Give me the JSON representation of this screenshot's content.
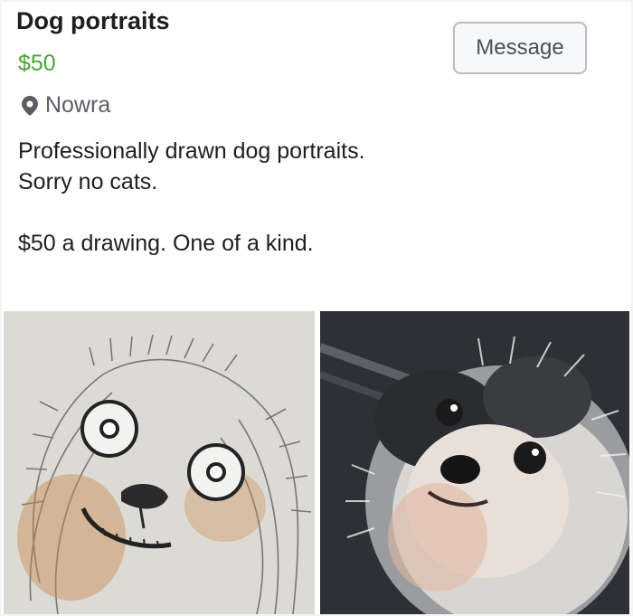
{
  "listing": {
    "title": "Dog portraits",
    "price": "$50",
    "location": "Nowra",
    "description": [
      "Professionally drawn dog portraits.",
      "Sorry no cats.",
      "",
      "$50 a drawing. One of a kind."
    ],
    "message_label": "Message"
  },
  "icons": {
    "location": "location-pin-icon"
  },
  "colors": {
    "price": "#4aa33b",
    "muted_text": "#5a5e63"
  },
  "images": [
    {
      "name": "drawn-portrait-image",
      "content": "crayon drawing of a shaggy dog"
    },
    {
      "name": "dog-photo-image",
      "content": "photo of a shih tzu dog"
    }
  ]
}
